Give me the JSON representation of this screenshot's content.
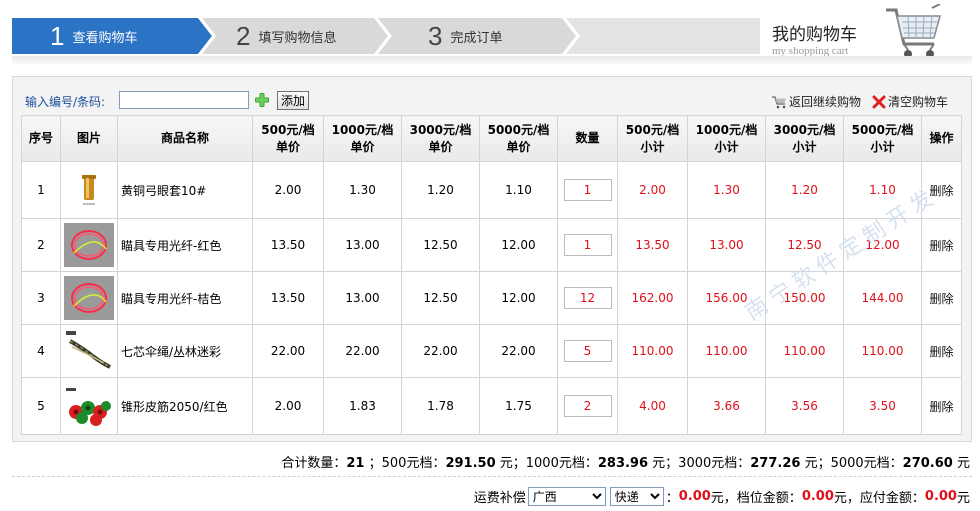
{
  "steps": [
    {
      "num": "1",
      "label": "查看购物车"
    },
    {
      "num": "2",
      "label": "填写购物信息"
    },
    {
      "num": "3",
      "label": "完成订单"
    }
  ],
  "brand": {
    "title_zh": "我的购物车",
    "title_en": "my shopping cart"
  },
  "toolbar": {
    "code_label": "输入编号/条码:",
    "code_value": "",
    "add_label": "添加",
    "back_label": "返回继续购物",
    "clear_label": "清空购物车"
  },
  "table": {
    "headers": {
      "seq": "序号",
      "image": "图片",
      "name": "商品名称",
      "p500": [
        "500元/档",
        "单价"
      ],
      "p1000": [
        "1000元/档",
        "单价"
      ],
      "p3000": [
        "3000元/档",
        "单价"
      ],
      "p5000": [
        "5000元/档",
        "单价"
      ],
      "qty": "数量",
      "s500": [
        "500元/档",
        "小计"
      ],
      "s1000": [
        "1000元/档",
        "小计"
      ],
      "s3000": [
        "3000元/档",
        "小计"
      ],
      "s5000": [
        "5000元/档",
        "小计"
      ],
      "action": "操作"
    },
    "delete_label": "删除",
    "rows": [
      {
        "seq": "1",
        "name": "黄铜弓眼套10#",
        "thumb": "brass-sleeve",
        "p500": "2.00",
        "p1000": "1.30",
        "p3000": "1.20",
        "p5000": "1.10",
        "qty": "1",
        "s500": "2.00",
        "s1000": "1.30",
        "s3000": "1.20",
        "s5000": "1.10"
      },
      {
        "seq": "2",
        "name": "瞄具专用光纤-红色",
        "thumb": "fiber-coil",
        "p500": "13.50",
        "p1000": "13.00",
        "p3000": "12.50",
        "p5000": "12.00",
        "qty": "1",
        "s500": "13.50",
        "s1000": "13.00",
        "s3000": "12.50",
        "s5000": "12.00"
      },
      {
        "seq": "3",
        "name": "瞄具专用光纤-桔色",
        "thumb": "fiber-coil",
        "p500": "13.50",
        "p1000": "13.00",
        "p3000": "12.50",
        "p5000": "12.00",
        "qty": "12",
        "s500": "162.00",
        "s1000": "156.00",
        "s3000": "150.00",
        "s5000": "144.00"
      },
      {
        "seq": "4",
        "name": "七芯伞绳/丛林迷彩",
        "thumb": "paracord",
        "p500": "22.00",
        "p1000": "22.00",
        "p3000": "22.00",
        "p5000": "22.00",
        "qty": "5",
        "s500": "110.00",
        "s1000": "110.00",
        "s3000": "110.00",
        "s5000": "110.00"
      },
      {
        "seq": "5",
        "name": "锥形皮筋2050/红色",
        "thumb": "rubber-bands",
        "p500": "2.00",
        "p1000": "1.83",
        "p3000": "1.78",
        "p5000": "1.75",
        "qty": "2",
        "s500": "4.00",
        "s1000": "3.66",
        "s3000": "3.56",
        "s5000": "3.50"
      }
    ]
  },
  "summary": {
    "total_qty_label": "合计数量：",
    "total_qty": "21",
    "tier500_label": "；500元档：",
    "tier500": "291.50",
    "tier1000_label": "元；1000元档：",
    "tier1000": "283.96",
    "tier3000_label": "元；3000元档：",
    "tier3000": "277.26",
    "tier5000_label": "元；5000元档：",
    "tier5000": "270.60",
    "unit": "元"
  },
  "shipping": {
    "label": "运费补偿",
    "region": "广西",
    "method": "快递",
    "fee_prefix": "：",
    "fee": "0.00",
    "tier_label": "元，档位金额：",
    "tier_amount": "0.00",
    "payable_label": "元，应付金额：",
    "payable": "0.00",
    "unit": "元"
  },
  "watermark": "南宁软件定制开发",
  "colors": {
    "step_active": "#2b73c4",
    "step_inactive": "#d8d8d8",
    "subtotal_red": "#e0101a",
    "link_blue": "#1f4f9f"
  }
}
